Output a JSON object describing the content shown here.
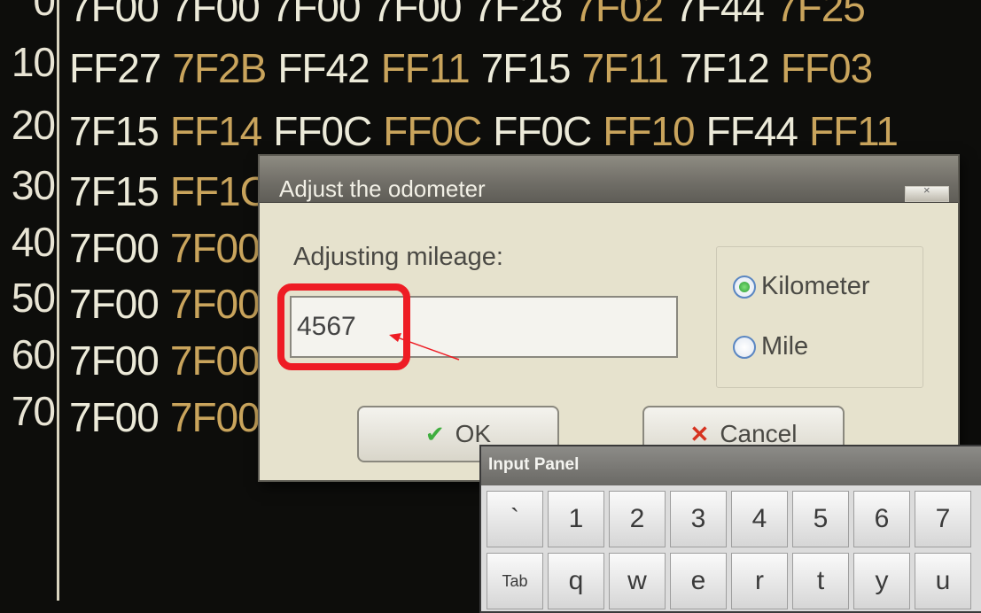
{
  "hex_view": {
    "rows": [
      {
        "offset": "0",
        "cells": [
          [
            "7F00",
            "w"
          ],
          [
            "7F00",
            "w"
          ],
          [
            "7F00",
            "w"
          ],
          [
            "7F00",
            "w"
          ],
          [
            "7F28",
            "w"
          ],
          [
            "7F02",
            "g"
          ],
          [
            "7F44",
            "w"
          ],
          [
            "7F25",
            "g"
          ]
        ]
      },
      {
        "offset": "10",
        "cells": [
          [
            "FF27",
            "w"
          ],
          [
            "7F2B",
            "g"
          ],
          [
            "FF42",
            "w"
          ],
          [
            "FF11",
            "g"
          ],
          [
            "7F15",
            "w"
          ],
          [
            "7F11",
            "g"
          ],
          [
            "7F12",
            "w"
          ],
          [
            "FF03",
            "g"
          ]
        ]
      },
      {
        "offset": "20",
        "cells": [
          [
            "7F15",
            "w"
          ],
          [
            "FF14",
            "g"
          ],
          [
            "FF0C",
            "w"
          ],
          [
            "FF0C",
            "g"
          ],
          [
            "FF0C",
            "w"
          ],
          [
            "FF10",
            "g"
          ],
          [
            "FF44",
            "w"
          ],
          [
            "FF11",
            "g"
          ]
        ]
      },
      {
        "offset": "30",
        "cells": [
          [
            "7F15",
            "w"
          ],
          [
            "FF1C",
            "g"
          ]
        ]
      },
      {
        "offset": "40",
        "cells": [
          [
            "7F00",
            "w"
          ],
          [
            "7F00",
            "g"
          ]
        ]
      },
      {
        "offset": "50",
        "cells": [
          [
            "7F00",
            "w"
          ],
          [
            "7F00",
            "g"
          ]
        ]
      },
      {
        "offset": "60",
        "cells": [
          [
            "7F00",
            "w"
          ],
          [
            "7F00",
            "g"
          ]
        ]
      },
      {
        "offset": "70",
        "cells": [
          [
            "7F00",
            "w"
          ],
          [
            "7F00",
            "g"
          ]
        ]
      }
    ]
  },
  "dialog": {
    "title": "Adjust the odometer",
    "mileage_label": "Adjusting mileage:",
    "mileage_value": "4567",
    "units": [
      {
        "label": "Kilometer",
        "checked": true
      },
      {
        "label": "Mile",
        "checked": false
      }
    ],
    "ok_label": "OK",
    "cancel_label": "Cancel",
    "ok_icon": "check-icon",
    "cancel_icon": "x-icon"
  },
  "input_panel": {
    "title": "Input Panel",
    "row1": [
      "`",
      "1",
      "2",
      "3",
      "4",
      "5",
      "6",
      "7"
    ],
    "row2": [
      "Tab",
      "q",
      "w",
      "e",
      "r",
      "t",
      "y",
      "u"
    ]
  },
  "colors": {
    "highlight": "#ee1c24",
    "hex_white": "#ecead9",
    "hex_gold": "#c9a45c"
  }
}
